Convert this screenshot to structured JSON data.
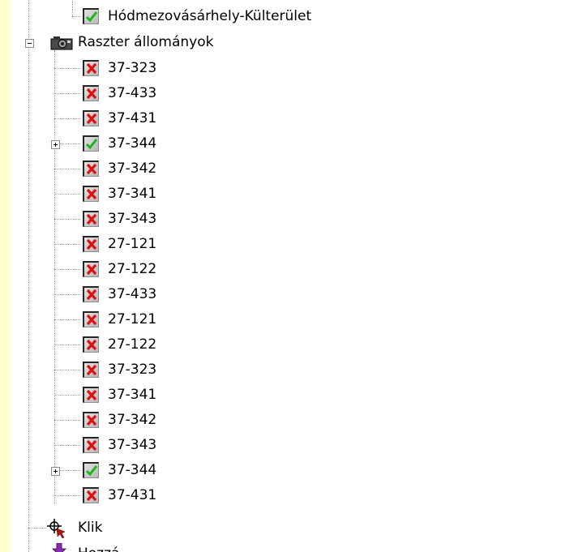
{
  "tree": {
    "top_item": {
      "label": "Hódmezovásárhely-Külterület",
      "checked": true
    },
    "raster_group": {
      "label": "Raszter állományok",
      "expanded": true,
      "icon": "camera-icon"
    },
    "raster_items": [
      {
        "label": "37-323",
        "checked": false,
        "expandable": false
      },
      {
        "label": "37-433",
        "checked": false,
        "expandable": false
      },
      {
        "label": "37-431",
        "checked": false,
        "expandable": false
      },
      {
        "label": "37-344",
        "checked": true,
        "expandable": true
      },
      {
        "label": "37-342",
        "checked": false,
        "expandable": false
      },
      {
        "label": "37-341",
        "checked": false,
        "expandable": false
      },
      {
        "label": "37-343",
        "checked": false,
        "expandable": false
      },
      {
        "label": "27-121",
        "checked": false,
        "expandable": false
      },
      {
        "label": "27-122",
        "checked": false,
        "expandable": false
      },
      {
        "label": "37-433",
        "checked": false,
        "expandable": false
      },
      {
        "label": "27-121",
        "checked": false,
        "expandable": false
      },
      {
        "label": "27-122",
        "checked": false,
        "expandable": false
      },
      {
        "label": "37-323",
        "checked": false,
        "expandable": false
      },
      {
        "label": "37-341",
        "checked": false,
        "expandable": false
      },
      {
        "label": "37-342",
        "checked": false,
        "expandable": false
      },
      {
        "label": "37-343",
        "checked": false,
        "expandable": false
      },
      {
        "label": "37-344",
        "checked": true,
        "expandable": true
      },
      {
        "label": "37-431",
        "checked": false,
        "expandable": false
      }
    ],
    "klik_item": {
      "label": "Klik",
      "icon": "crosshair-pointer-icon"
    },
    "partial_item": {
      "label": "Hozzá",
      "icon": "purple-arrow-icon"
    }
  },
  "colors": {
    "background": "#FFFFD0",
    "panel": "#FFFFFF",
    "check_green": "#1FB51F",
    "cross_red": "#E01010"
  }
}
